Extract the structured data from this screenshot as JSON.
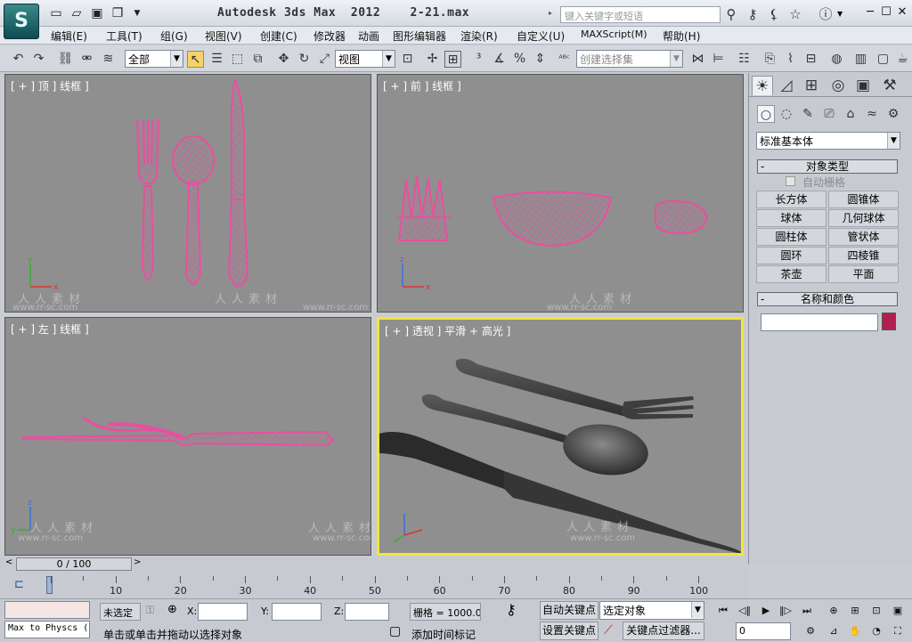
{
  "app": {
    "title": "Autodesk 3ds Max  2012    2-21.max",
    "search_placeholder": "键入关键字或短语",
    "logo": "S"
  },
  "menu": [
    "编辑(E)",
    "工具(T)",
    "组(G)",
    "视图(V)",
    "创建(C)",
    "修改器",
    "动画",
    "图形编辑器",
    "渲染(R)",
    "自定义(U)",
    "MAXScript(M)",
    "帮助(H)"
  ],
  "toolbar": {
    "selection_filter": "全部",
    "reference_coord": "视图",
    "named_selection": "创建选择集"
  },
  "viewports": [
    {
      "label": "[ + ] 顶 ] 线框 ]"
    },
    {
      "label": "[ + ] 前 ] 线框 ]"
    },
    {
      "label": "[ + ] 左 ] 线框 ]"
    },
    {
      "label": "[ + ] 透视 ] 平滑 + 高光 ]"
    }
  ],
  "watermark": {
    "cn": "人人素材",
    "url": "www.rr-sc.com"
  },
  "command_panel": {
    "category": "标准基本体",
    "object_type_title": "对象类型",
    "autogrid_label": "自动栅格",
    "buttons": [
      "长方体",
      "圆锥体",
      "球体",
      "几何球体",
      "圆柱体",
      "管状体",
      "圆环",
      "四棱锥",
      "茶壶",
      "平面"
    ],
    "name_color_title": "名称和颜色",
    "object_name": "",
    "object_color": "#b3204f"
  },
  "timeline": {
    "frame_display": "0 / 100",
    "ticks": [
      "10",
      "20",
      "30",
      "40",
      "50",
      "60",
      "70",
      "80",
      "90",
      "100"
    ]
  },
  "status": {
    "listener_text": "Max to Physcs (",
    "selection": "未选定",
    "x_label": "X:",
    "y_label": "Y:",
    "z_label": "Z:",
    "grid": "栅格 = 1000.0",
    "prompt": "单击或单击并拖动以选择对象",
    "add_time_tag": "添加时间标记",
    "auto_key": "自动关键点",
    "set_key": "设置关键点",
    "key_mode": "选定对象",
    "key_filters": "关键点过滤器...",
    "current_frame": "0"
  },
  "colors": {
    "wireframe": "#e8509f",
    "viewport_bg": "#8f8f8f",
    "active_border": "#f0e63a"
  }
}
